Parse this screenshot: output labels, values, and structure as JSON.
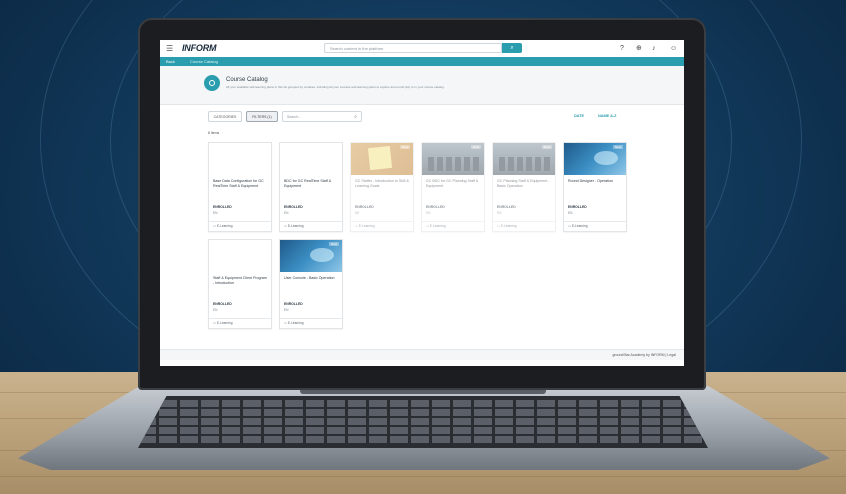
{
  "app": {
    "logo": "INFORM",
    "search_placeholder": "Search content in the platform",
    "nav": {
      "back_label": "Back",
      "breadcrumb": "Course Catalog"
    }
  },
  "header": {
    "title": "Course Catalog",
    "subtitle": "All your available self-learning plans in this list grouped by modules, including all your courses and learning plans to explore and enroll (sic) to in your course catalog."
  },
  "toolbar": {
    "categories_label": "CATEGORIES",
    "filters_label": "FILTERS (1)",
    "search_placeholder": "Search...",
    "sort_date": "DATE",
    "sort_name": "NAME A-Z"
  },
  "count_label": "8 items",
  "courses": [
    {
      "title": "Base Data Configuration for GC RealTime Staff & Equipment",
      "status": "ENROLLED",
      "lang": "EN",
      "type": "E-Learning",
      "image": "equipment",
      "badge": "",
      "dim": false
    },
    {
      "title": "BDC for GC RealTime Staff & Equipment",
      "status": "ENROLLED",
      "lang": "EN",
      "type": "E-Learning",
      "image": "equipment",
      "badge": "",
      "dim": false
    },
    {
      "title": "GC Staffer - Introduction to Skill & Learning Goals",
      "status": "ENROLLED",
      "lang": "DE",
      "type": "E-Learning",
      "image": "note",
      "badge": "New",
      "dim": true
    },
    {
      "title": "GC BDC for GC Planning Staff & Equipment",
      "status": "ENROLLED",
      "lang": "EN",
      "type": "E-Learning",
      "image": "factory",
      "badge": "New",
      "dim": true
    },
    {
      "title": "GC Planning Staff & Equipment - Basic Operation",
      "status": "ENROLLED",
      "lang": "EN",
      "type": "E-Learning",
      "image": "factory",
      "badge": "New",
      "dim": true
    },
    {
      "title": "Round Designer - Operation",
      "status": "ENROLLED",
      "lang": "EN",
      "type": "E-Learning",
      "image": "digital",
      "badge": "New",
      "dim": false
    },
    {
      "title": "Staff & Equipment Client Program - Introduction",
      "status": "ENROLLED",
      "lang": "EN",
      "type": "E-Learning",
      "image": "equipment",
      "badge": "",
      "dim": false
    },
    {
      "title": "User Console - Basic Operation",
      "status": "ENROLLED",
      "lang": "EN",
      "type": "E-Learning",
      "image": "digital",
      "badge": "New",
      "dim": false
    }
  ],
  "footer": {
    "text": "groundStar Academy by INFORM | Legal"
  },
  "colors": {
    "accent": "#2a9dae",
    "background": "#0d2c49",
    "desk": "#c9b28d"
  },
  "icons": {
    "menu": "hamburger-icon",
    "search": "search-icon",
    "help": "help-icon",
    "cart": "cart-icon",
    "notifications": "bell-icon",
    "user": "user-icon"
  }
}
